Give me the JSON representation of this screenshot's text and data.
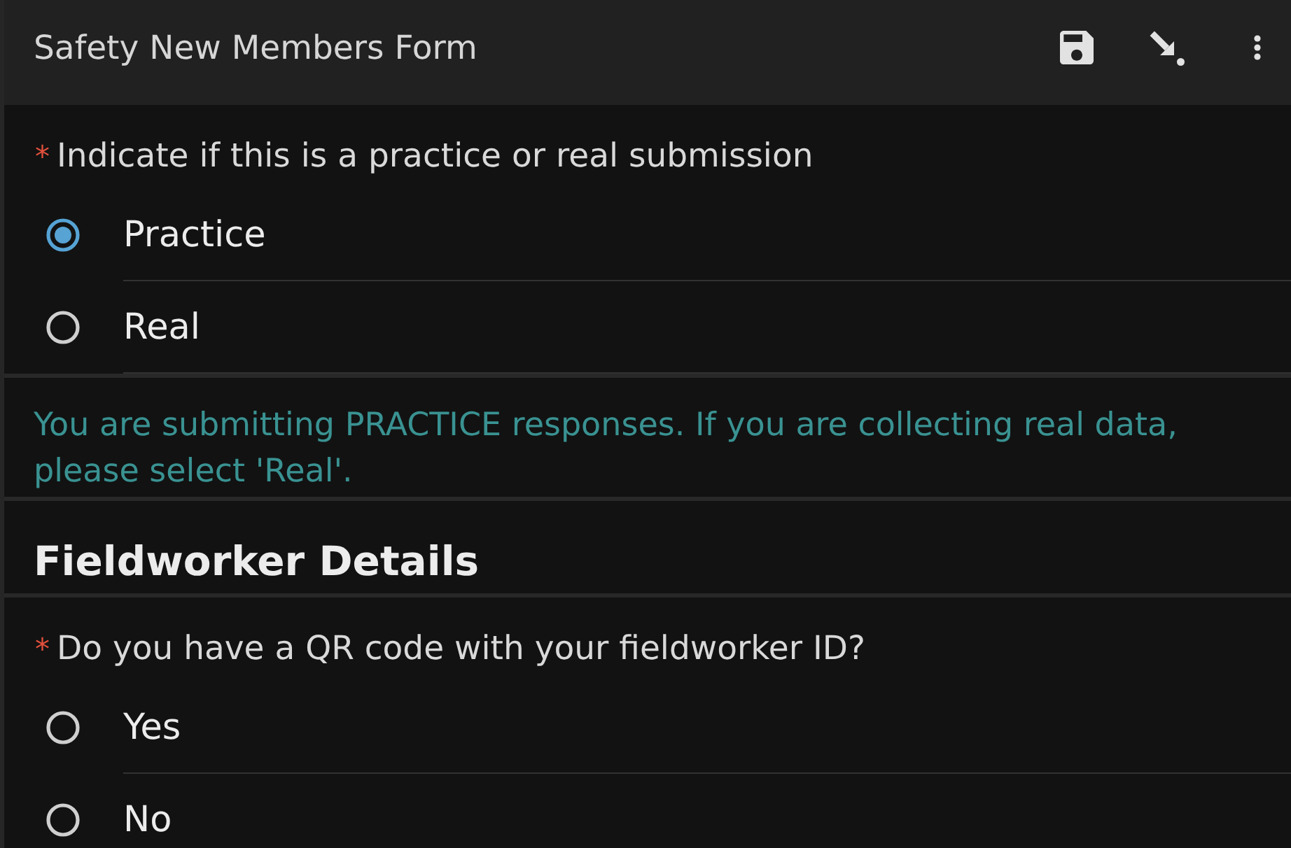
{
  "app_bar": {
    "title": "Safety New Members Form"
  },
  "form": [
    {
      "kind": "question",
      "required_mark": "*",
      "label": "Indicate if this is a practice or real submission",
      "options": [
        {
          "label": "Practice",
          "selected": true
        },
        {
          "label": "Real",
          "selected": false
        }
      ]
    },
    {
      "kind": "note",
      "text": "You are submitting PRACTICE responses. If you are collecting real data, please select 'Real'."
    },
    {
      "kind": "heading",
      "text": "Fieldworker Details"
    },
    {
      "kind": "question",
      "required_mark": "*",
      "label": "Do you have a QR code with your fieldworker ID?",
      "options": [
        {
          "label": "Yes",
          "selected": false
        },
        {
          "label": "No",
          "selected": false
        }
      ]
    }
  ]
}
